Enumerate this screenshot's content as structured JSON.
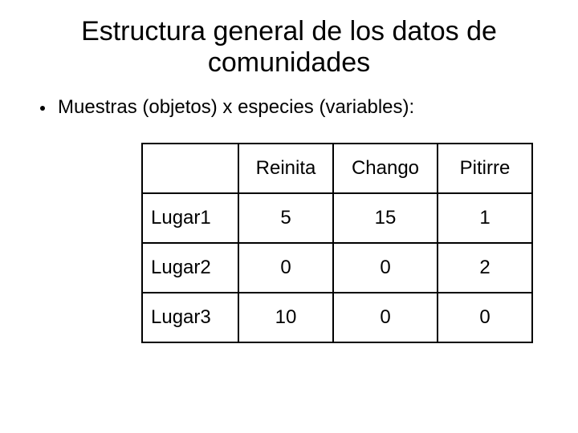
{
  "title": "Estructura general de los datos de comunidades",
  "bullet": "Muestras (objetos) x especies (variables):",
  "chart_data": {
    "type": "table",
    "columns": [
      "Reinita",
      "Chango",
      "Pitirre"
    ],
    "rows": [
      "Lugar1",
      "Lugar2",
      "Lugar3"
    ],
    "values": [
      [
        5,
        15,
        1
      ],
      [
        0,
        0,
        2
      ],
      [
        10,
        0,
        0
      ]
    ]
  }
}
